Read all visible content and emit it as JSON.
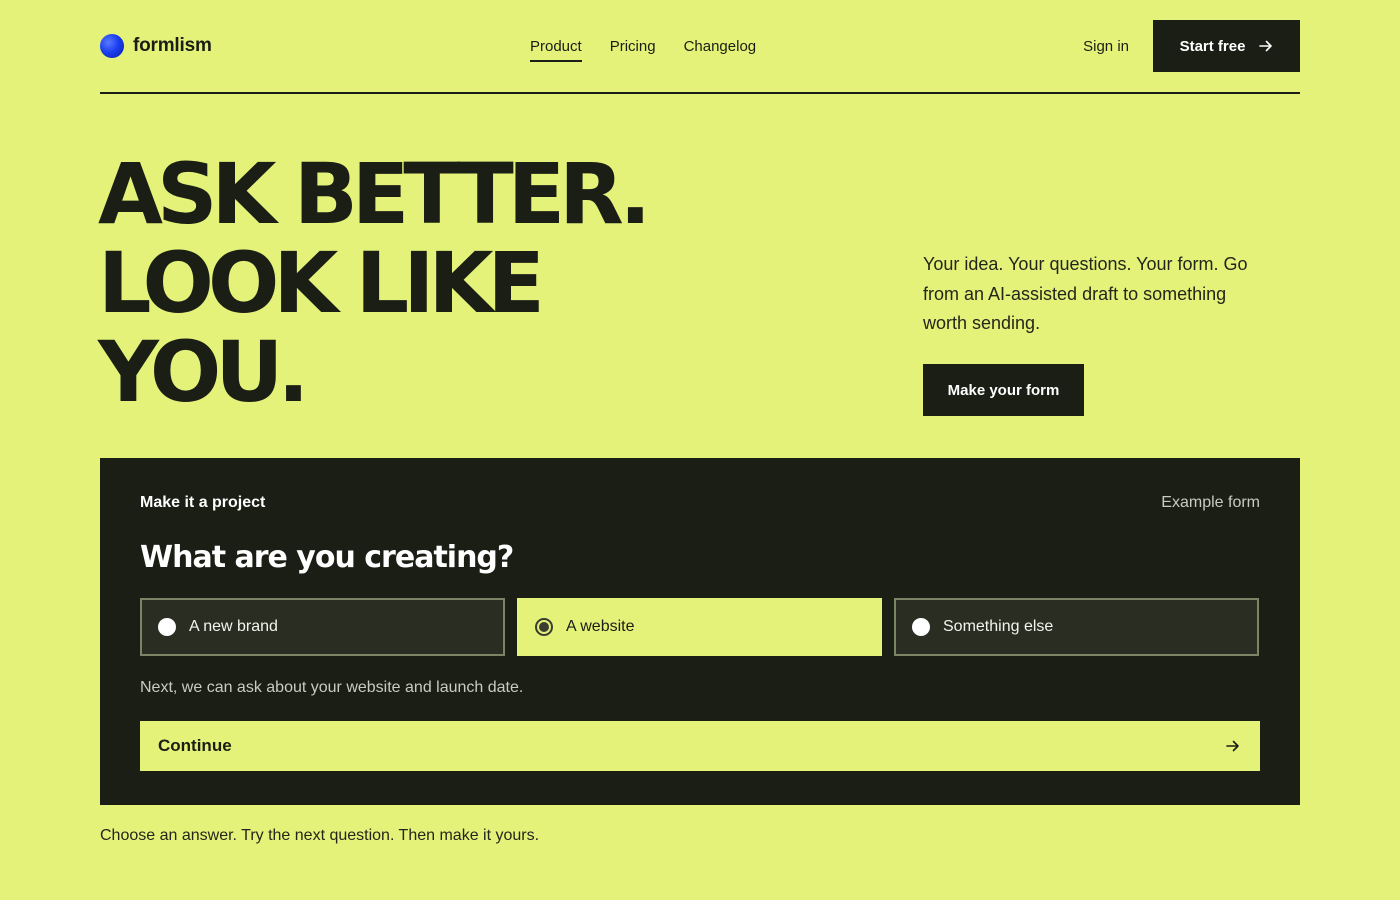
{
  "header": {
    "brand": {
      "name": "formlism",
      "logo_icon": "globe-logo-icon"
    },
    "nav": [
      {
        "label": "Product",
        "active": true
      },
      {
        "label": "Pricing",
        "active": false
      },
      {
        "label": "Changelog",
        "active": false
      }
    ],
    "sign_in": "Sign in",
    "start_free": "Start free"
  },
  "hero": {
    "title_lines": [
      "ASK BETTER.",
      "LOOK LIKE",
      "YOU."
    ],
    "description": "Your idea. Your questions. Your form. Go from an AI-assisted draft to something worth sending.",
    "cta": "Make your form"
  },
  "form_panel": {
    "project_label": "Make it a project",
    "example_label": "Example form",
    "question": "What are you creating?",
    "options": [
      {
        "label": "A new brand",
        "selected": false
      },
      {
        "label": "A website",
        "selected": true
      },
      {
        "label": "Something else",
        "selected": false
      }
    ],
    "hint": "Next, we can ask about your website and launch date.",
    "continue": "Continue"
  },
  "footer_note": "Choose an answer. Try the next question. Then make it yours.",
  "colors": {
    "background": "#e4f279",
    "dark": "#1b1e15",
    "accent_blue": "#1a3ff0"
  }
}
